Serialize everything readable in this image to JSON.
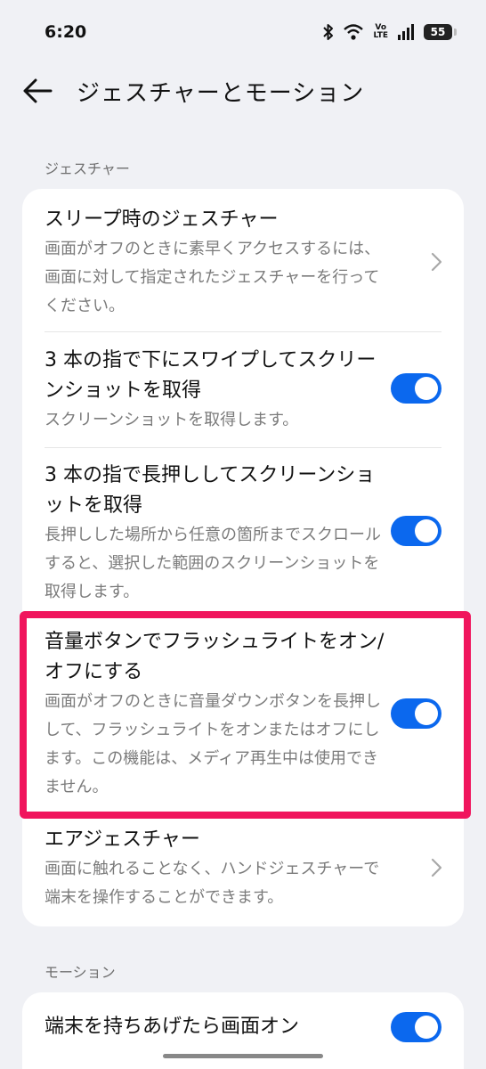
{
  "status_bar": {
    "time": "6:20",
    "volte_top": "Vo",
    "volte_bottom": "LTE",
    "battery": "55"
  },
  "header": {
    "title": "ジェスチャーとモーション"
  },
  "sections": {
    "gesture_label": "ジェスチャー",
    "motion_label": "モーション"
  },
  "gesture_items": [
    {
      "title": "スリープ時のジェスチャー",
      "subtitle": "画面がオフのときに素早くアクセスするには、画面に対して指定されたジェスチャーを行ってください。",
      "control": "chevron"
    },
    {
      "title": "3 本の指で下にスワイプしてスクリーンショットを取得",
      "subtitle": "スクリーンショットを取得します。",
      "control": "toggle",
      "enabled": true
    },
    {
      "title": "3 本の指で長押ししてスクリーンショットを取得",
      "subtitle": "長押しした場所から任意の箇所までスクロールすると、選択した範囲のスクリーンショットを取得します。",
      "control": "toggle",
      "enabled": true
    },
    {
      "title": "音量ボタンでフラッシュライトをオン/オフにする",
      "subtitle": "画面がオフのときに音量ダウンボタンを長押しして、フラッシュライトをオンまたはオフにします。この機能は、メディア再生中は使用できません。",
      "control": "toggle",
      "enabled": true
    },
    {
      "title": "エアジェスチャー",
      "subtitle": "画面に触れることなく、ハンドジェスチャーで端末を操作することができます。",
      "control": "chevron"
    }
  ],
  "motion_items": [
    {
      "title": "端末を持ちあげたら画面オン",
      "control": "toggle",
      "enabled": true
    }
  ],
  "colors": {
    "accent": "#0b68ee",
    "highlight": "#f0155d",
    "background": "#f0f1f5"
  }
}
